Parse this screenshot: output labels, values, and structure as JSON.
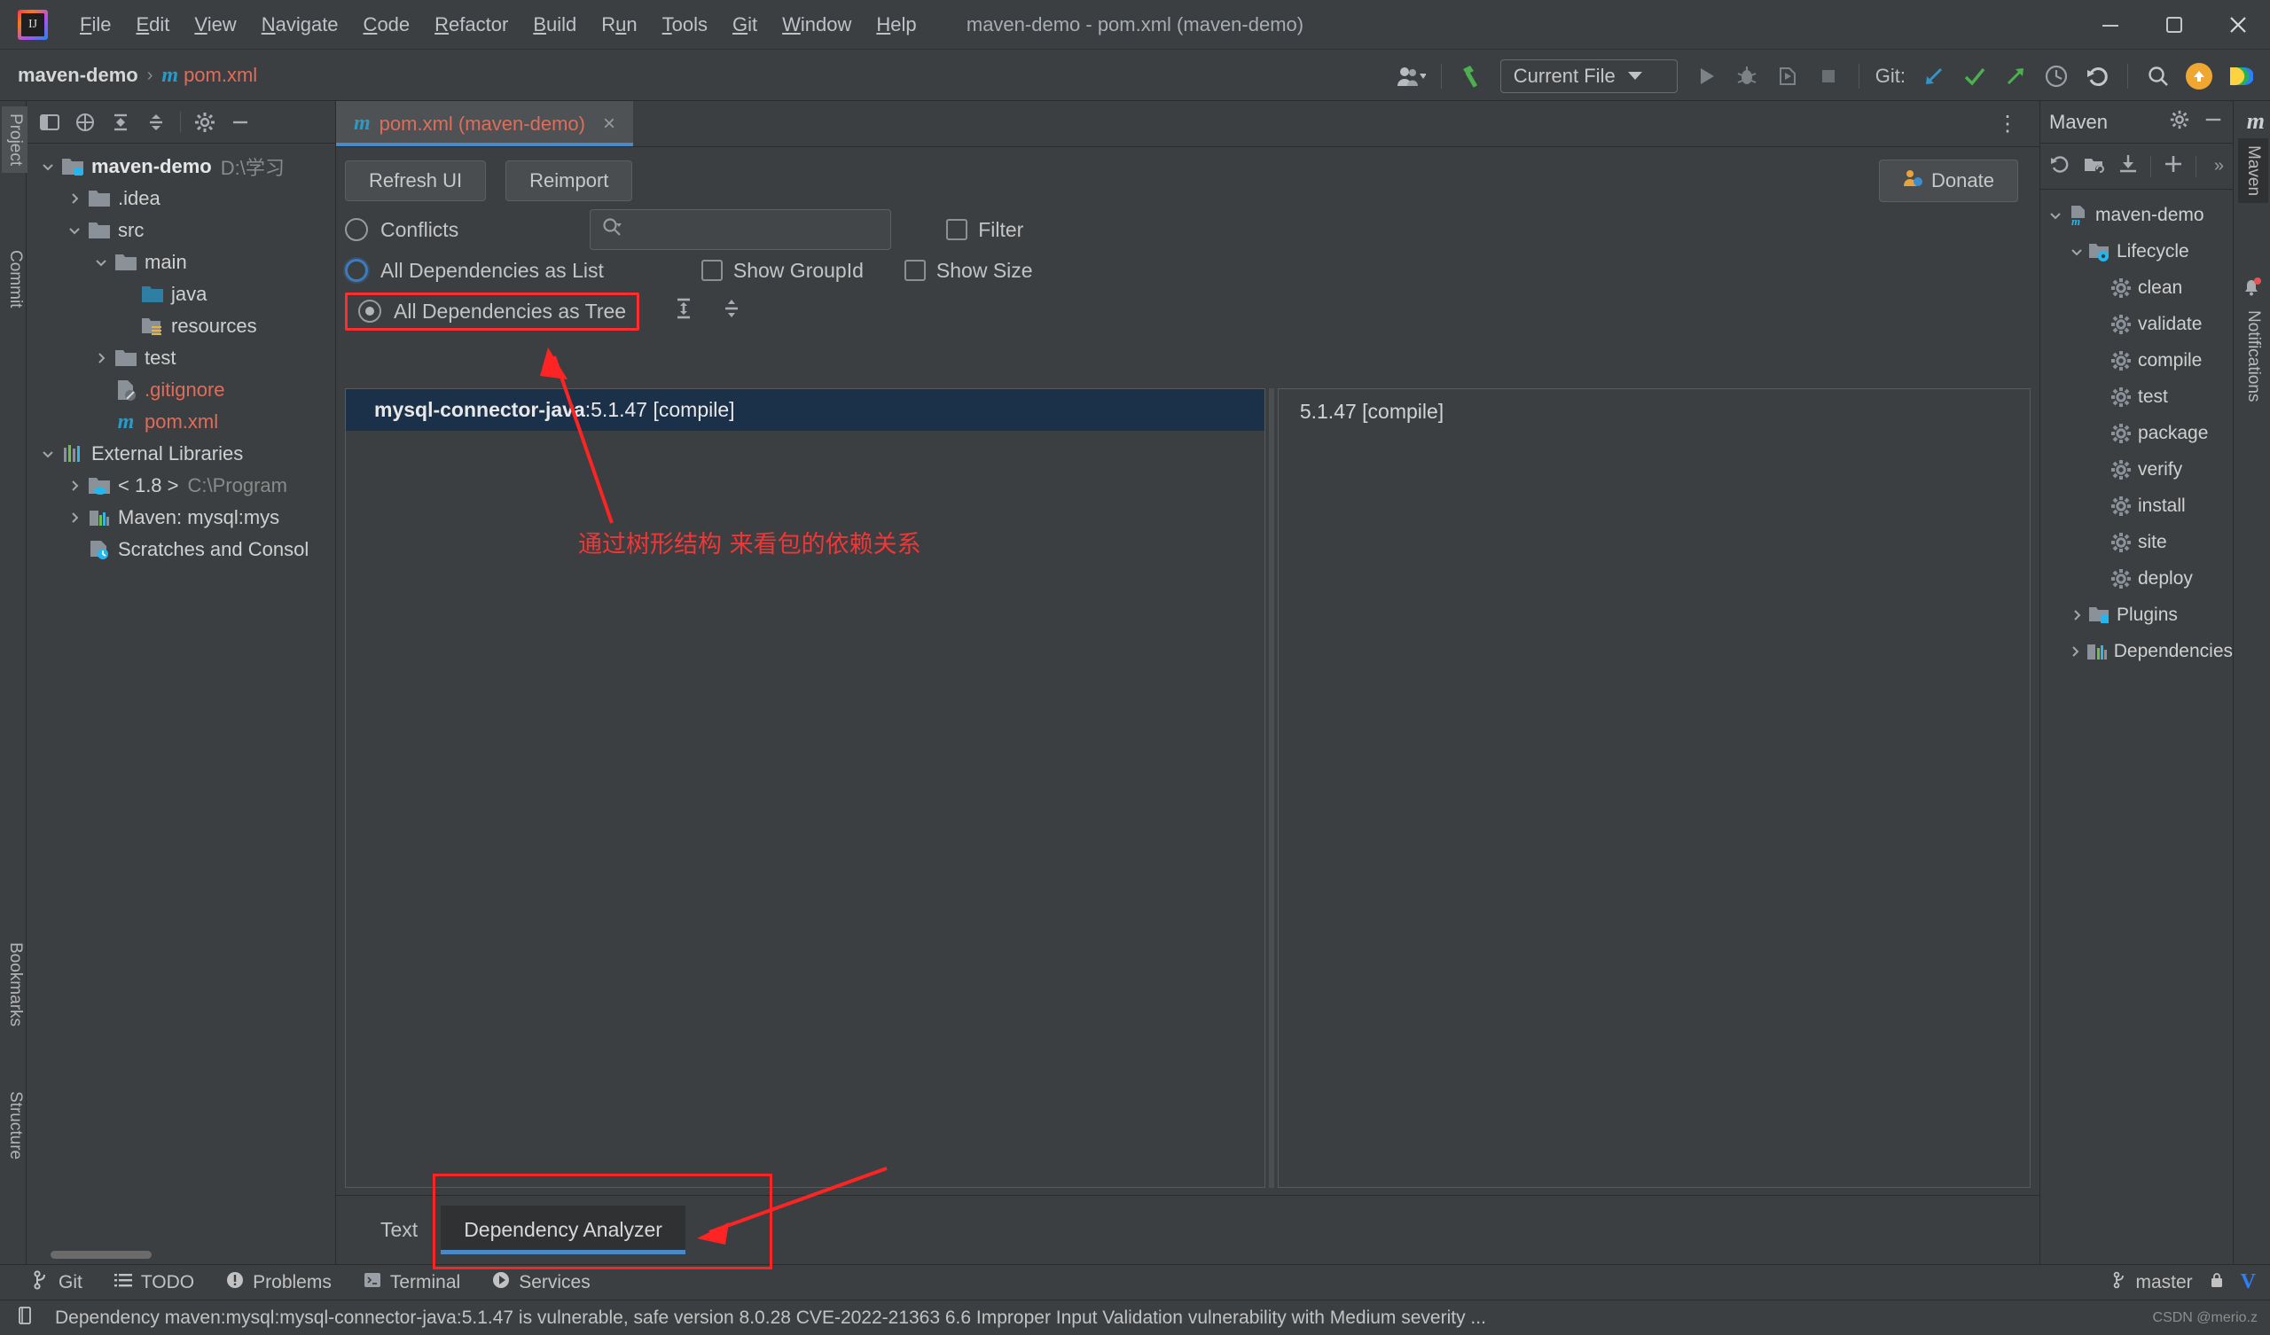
{
  "window": {
    "title": "maven-demo - pom.xml (maven-demo)",
    "logo_text": "IJ",
    "minimize": "minimize-icon",
    "maximize": "maximize-icon",
    "close": "close-icon"
  },
  "menu": [
    {
      "label": "File",
      "mnemonic": "F"
    },
    {
      "label": "Edit",
      "mnemonic": "E"
    },
    {
      "label": "View",
      "mnemonic": "V"
    },
    {
      "label": "Navigate",
      "mnemonic": "N"
    },
    {
      "label": "Code",
      "mnemonic": "C"
    },
    {
      "label": "Refactor",
      "mnemonic": "R"
    },
    {
      "label": "Build",
      "mnemonic": "B"
    },
    {
      "label": "Run",
      "mnemonic": "u"
    },
    {
      "label": "Tools",
      "mnemonic": "T"
    },
    {
      "label": "Git",
      "mnemonic": "G"
    },
    {
      "label": "Window",
      "mnemonic": "W"
    },
    {
      "label": "Help",
      "mnemonic": "H"
    }
  ],
  "navbar": {
    "crumb_project": "maven-demo",
    "crumb_sep": "›",
    "crumb_file": "pom.xml",
    "crumb_file_icon_letter": "m",
    "run_config": "Current File",
    "git_label": "Git:"
  },
  "left_tool_strip": [
    {
      "label": "Project",
      "selected": true
    },
    {
      "label": "Commit",
      "selected": false
    },
    {
      "label": "Bookmarks",
      "selected": false
    },
    {
      "label": "Structure",
      "selected": false
    }
  ],
  "project_panel": {
    "toolbar_icons": [
      "select-opened-file-icon",
      "flatten-packages-icon",
      "expand-all-icon",
      "collapse-all-icon",
      "settings-icon",
      "hide-icon"
    ],
    "tree": [
      {
        "label": "maven-demo",
        "path": "D:\\学习",
        "icon": "module-folder-icon",
        "depth": 0,
        "arrow": "down",
        "bold": true
      },
      {
        "label": ".idea",
        "path": "",
        "icon": "folder-icon",
        "depth": 1,
        "arrow": "right",
        "bold": false
      },
      {
        "label": "src",
        "path": "",
        "icon": "folder-icon",
        "depth": 1,
        "arrow": "down",
        "bold": false
      },
      {
        "label": "main",
        "path": "",
        "icon": "folder-icon",
        "depth": 2,
        "arrow": "down",
        "bold": false
      },
      {
        "label": "java",
        "path": "",
        "icon": "source-folder-icon",
        "depth": 3,
        "arrow": "",
        "bold": false
      },
      {
        "label": "resources",
        "path": "",
        "icon": "resources-folder-icon",
        "depth": 3,
        "arrow": "",
        "bold": false
      },
      {
        "label": "test",
        "path": "",
        "icon": "folder-icon",
        "depth": 2,
        "arrow": "right",
        "bold": false
      },
      {
        "label": ".gitignore",
        "path": "",
        "icon": "gitignore-icon",
        "depth": 2,
        "arrow": "",
        "bold": false,
        "red": true
      },
      {
        "label": "pom.xml",
        "path": "",
        "icon": "maven-file-icon",
        "depth": 2,
        "arrow": "",
        "bold": false,
        "red": true
      },
      {
        "label": "External Libraries",
        "path": "",
        "icon": "libraries-icon",
        "depth": 0,
        "arrow": "down",
        "bold": false
      },
      {
        "label": "< 1.8 >",
        "path": "C:\\Program",
        "icon": "jdk-icon",
        "depth": 1,
        "arrow": "right",
        "bold": false
      },
      {
        "label": "Maven: mysql:mys",
        "path": "",
        "icon": "maven-lib-icon",
        "depth": 1,
        "arrow": "right",
        "bold": false
      },
      {
        "label": "Scratches and Consol",
        "path": "",
        "icon": "scratches-icon",
        "depth": 1,
        "arrow": "",
        "bold": false
      }
    ]
  },
  "editor": {
    "tab": {
      "label": "pom.xml (maven-demo)",
      "icon_letter": "m",
      "close": "×"
    },
    "overflow_menu": "more-options-icon",
    "buttons": {
      "refresh": "Refresh UI",
      "reimport": "Reimport",
      "donate": "Donate"
    },
    "options": {
      "conflicts": "Conflicts",
      "all_as_list": "All Dependencies as List",
      "all_as_tree": "All Dependencies as Tree",
      "filter": "Filter",
      "show_group_id": "Show GroupId",
      "show_size": "Show Size",
      "search_placeholder": ""
    },
    "selected_dependency": {
      "name": "mysql-connector-java",
      "separator": " : ",
      "version_scope": "5.1.47 [compile]"
    },
    "right_pane_row": "5.1.47 [compile]",
    "bottom_tabs": [
      {
        "label": "Text",
        "selected": false
      },
      {
        "label": "Dependency Analyzer",
        "selected": true
      }
    ]
  },
  "maven_panel": {
    "title": "Maven",
    "header_icons": [
      "settings-icon",
      "hide-icon"
    ],
    "toolbar_icons": [
      "reload-icon",
      "add-maven-project-icon",
      "download-sources-icon",
      "add-icon",
      "expand-toolbar-icon"
    ],
    "toolbar_overflow": "»",
    "tree": [
      {
        "label": "maven-demo",
        "icon": "maven-project-icon",
        "depth": 0,
        "arrow": "down"
      },
      {
        "label": "Lifecycle",
        "icon": "lifecycle-folder-icon",
        "depth": 1,
        "arrow": "down"
      },
      {
        "label": "clean",
        "icon": "goal-icon",
        "depth": 2,
        "arrow": ""
      },
      {
        "label": "validate",
        "icon": "goal-icon",
        "depth": 2,
        "arrow": ""
      },
      {
        "label": "compile",
        "icon": "goal-icon",
        "depth": 2,
        "arrow": ""
      },
      {
        "label": "test",
        "icon": "goal-icon",
        "depth": 2,
        "arrow": ""
      },
      {
        "label": "package",
        "icon": "goal-icon",
        "depth": 2,
        "arrow": ""
      },
      {
        "label": "verify",
        "icon": "goal-icon",
        "depth": 2,
        "arrow": ""
      },
      {
        "label": "install",
        "icon": "goal-icon",
        "depth": 2,
        "arrow": ""
      },
      {
        "label": "site",
        "icon": "goal-icon",
        "depth": 2,
        "arrow": ""
      },
      {
        "label": "deploy",
        "icon": "goal-icon",
        "depth": 2,
        "arrow": ""
      },
      {
        "label": "Plugins",
        "icon": "plugins-folder-icon",
        "depth": 1,
        "arrow": "right"
      },
      {
        "label": "Dependencies",
        "icon": "dependencies-icon",
        "depth": 1,
        "arrow": "right"
      }
    ]
  },
  "right_tool_strip": [
    {
      "label": "Maven",
      "selected": true,
      "icon": "maven-icon"
    },
    {
      "label": "Notifications",
      "selected": false,
      "icon": "notifications-icon"
    }
  ],
  "tool_window_bar": [
    {
      "label": "Git",
      "icon": "git-branch-icon"
    },
    {
      "label": "TODO",
      "icon": "todo-icon"
    },
    {
      "label": "Problems",
      "icon": "problems-icon"
    },
    {
      "label": "Terminal",
      "icon": "terminal-icon"
    },
    {
      "label": "Services",
      "icon": "services-icon"
    }
  ],
  "tool_window_bar_right": {
    "branch": "master",
    "lock": "lock-icon",
    "brand": "V"
  },
  "statusbar": {
    "message": "Dependency maven:mysql:mysql-connector-java:5.1.47 is vulnerable, safe version 8.0.28 CVE-2022-21363 6.6 Improper Input Validation vulnerability with Medium severity ...",
    "icon": "event-log-icon",
    "watermark": "CSDN @merio.z"
  },
  "annotations": {
    "chinese_note": "通过树形结构 来看包的依赖关系",
    "color": "#ff2424"
  },
  "colors": {
    "bg": "#3c3f41",
    "selection": "#1b3049",
    "accent_blue": "#4a88c7",
    "file_red": "#e06c5a",
    "maven_blue": "#2a9ac6",
    "annotation_red": "#ff2424",
    "donate_orange": "#f0a732"
  }
}
